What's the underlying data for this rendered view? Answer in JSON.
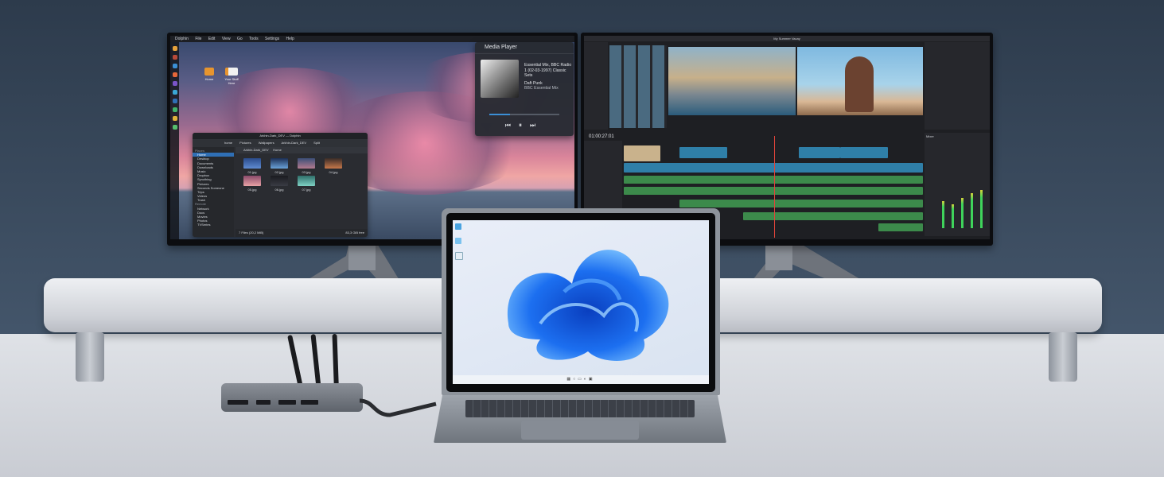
{
  "left_monitor": {
    "menubar": [
      "Dolphin",
      "File",
      "Edit",
      "View",
      "Go",
      "Tools",
      "Settings",
      "Help"
    ],
    "desktop_icons": [
      "Home",
      "Your Stuff Here"
    ],
    "file_manager": {
      "window_title": "Arkhin-Dark_DEV — Dolphin",
      "breadcrumb": [
        "home",
        "Pictures",
        "Wallpapers",
        "Arkhin-Dark_DEV"
      ],
      "split_label": "Split",
      "tab_label": "Arkhin-Dark_DEV",
      "location_label": "Home",
      "sidebar_places_header": "Places",
      "sidebar_places": [
        "Home",
        "Desktop",
        "Documents",
        "Downloads",
        "Music",
        "Dropbox",
        "Syncthing",
        "Pictures",
        "Seconds Someone",
        "Trips",
        "Videos",
        "Trash"
      ],
      "sidebar_remote_header": "Remote",
      "sidebar_remote": [
        "Network",
        "Docs",
        "Movies",
        "Photos",
        "TVSeries"
      ],
      "files": [
        "01.jpg",
        "02.jpg",
        "03.jpg",
        "04.jpg",
        "05.jpg",
        "06.jpg",
        "07.jpg"
      ],
      "status_left": "7 Files (20,2 MiB)",
      "status_right": "83,3 GiB free"
    },
    "media_player": {
      "title": "Media Player",
      "track_title": "Essential Mix, BBC Radio 1 (02-03-1997) Classic Sets",
      "artist": "Daft Punk",
      "album": "BBC Essential Mix"
    }
  },
  "right_monitor": {
    "title": "My Summer Vacay",
    "timecode": "01:00:27:01",
    "mixer_label": "Mixer"
  },
  "colors": {
    "accent_blue": "#2f6fb5",
    "timeline_blue": "#2f7fa8",
    "timeline_green": "#3c8a4b",
    "playhead": "#e0443a",
    "meter_green": "#3fd35b"
  }
}
